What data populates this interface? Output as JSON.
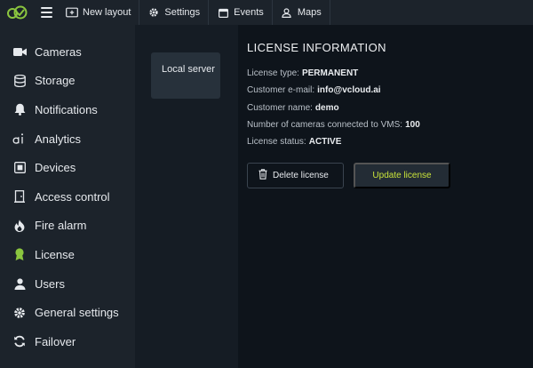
{
  "topbar": {
    "new_layout": "New layout",
    "settings": "Settings",
    "events": "Events",
    "maps": "Maps"
  },
  "sidebar": {
    "items": [
      {
        "label": "Cameras",
        "icon": "camera-icon"
      },
      {
        "label": "Storage",
        "icon": "database-icon"
      },
      {
        "label": "Notifications",
        "icon": "bell-icon"
      },
      {
        "label": "Analytics",
        "icon": "ai-icon"
      },
      {
        "label": "Devices",
        "icon": "device-icon"
      },
      {
        "label": "Access control",
        "icon": "door-icon"
      },
      {
        "label": "Fire alarm",
        "icon": "flame-icon"
      },
      {
        "label": "License",
        "icon": "award-icon"
      },
      {
        "label": "Users",
        "icon": "user-icon"
      },
      {
        "label": "General settings",
        "icon": "gear-icon"
      },
      {
        "label": "Failover",
        "icon": "sync-icon"
      }
    ],
    "active_index": 7
  },
  "server": {
    "label": "Local server"
  },
  "license": {
    "title": "LICENSE INFORMATION",
    "type_label": "License type:",
    "type_value": "PERMANENT",
    "email_label": "Customer e-mail:",
    "email_value": "info@vcloud.ai",
    "name_label": "Customer name:",
    "name_value": "demo",
    "cameras_label": "Number of cameras connected to VMS:",
    "cameras_value": "100",
    "status_label": "License status:",
    "status_value": "ACTIVE",
    "delete_button": "Delete license",
    "update_button": "Update license"
  },
  "colors": {
    "accent": "#c8e23a",
    "logo_green": "#8bc63f",
    "sidebar_bg": "#1c232b",
    "main_bg": "#0e141b"
  }
}
